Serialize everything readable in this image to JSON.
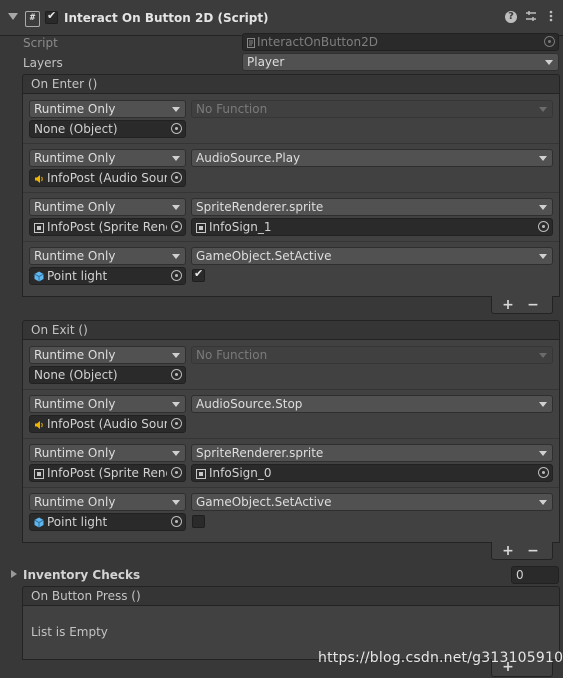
{
  "component": {
    "title": "Interact On Button 2D (Script)",
    "icons": [
      "fold-arrow-icon",
      "script-icon",
      "enabled-checkbox",
      "help-icon",
      "presets-icon",
      "kebab-menu-icon"
    ]
  },
  "fields": {
    "script_label": "Script",
    "script_value": "InteractOnButton2D",
    "layers_label": "Layers",
    "layers_value": "Player"
  },
  "on_enter": {
    "header": "On Enter ()",
    "rows": [
      {
        "mode": "Runtime Only",
        "target": "None (Object)",
        "function": "No Function",
        "arg": null
      },
      {
        "mode": "Runtime Only",
        "target": "InfoPost (Audio Source)",
        "function": "AudioSource.Play",
        "arg": null
      },
      {
        "mode": "Runtime Only",
        "target": "InfoPost (Sprite Renderer)",
        "function": "SpriteRenderer.sprite",
        "arg": "InfoSign_1"
      },
      {
        "mode": "Runtime Only",
        "target": "Point light",
        "function": "GameObject.SetActive",
        "arg": true
      }
    ],
    "add_label": "+",
    "remove_label": "−"
  },
  "on_exit": {
    "header": "On Exit ()",
    "rows": [
      {
        "mode": "Runtime Only",
        "target": "None (Object)",
        "function": "No Function",
        "arg": null
      },
      {
        "mode": "Runtime Only",
        "target": "InfoPost (Audio Source)",
        "function": "AudioSource.Stop",
        "arg": null
      },
      {
        "mode": "Runtime Only",
        "target": "InfoPost (Sprite Renderer)",
        "function": "SpriteRenderer.sprite",
        "arg": "InfoSign_0"
      },
      {
        "mode": "Runtime Only",
        "target": "Point light",
        "function": "GameObject.SetActive",
        "arg": false
      }
    ],
    "add_label": "+",
    "remove_label": "−"
  },
  "inventory": {
    "label": "Inventory Checks",
    "value": "0"
  },
  "on_button_press": {
    "header": "On Button Press ()",
    "empty_text": "List is Empty",
    "add_label": "+"
  },
  "watermark": "https://blog.csdn.net/g313105910"
}
